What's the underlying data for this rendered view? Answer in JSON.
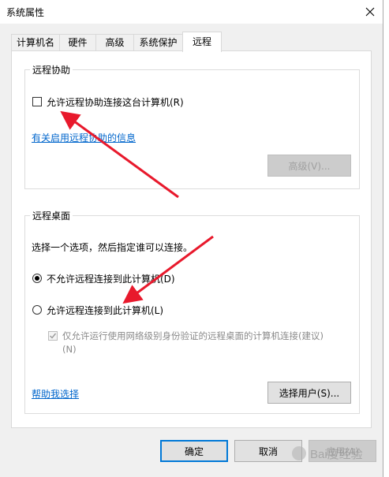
{
  "window": {
    "title": "系统属性",
    "close_icon": "close-icon"
  },
  "tabs": [
    {
      "label": "计算机名",
      "active": false
    },
    {
      "label": "硬件",
      "active": false
    },
    {
      "label": "高级",
      "active": false
    },
    {
      "label": "系统保护",
      "active": false
    },
    {
      "label": "远程",
      "active": true
    }
  ],
  "remote_assistance": {
    "title": "远程协助",
    "allow_label": "允许远程协助连接这台计算机(R)",
    "allow_checked": false,
    "info_link": "有关启用远程协助的信息",
    "advanced_button": "高级(V)..."
  },
  "remote_desktop": {
    "title": "远程桌面",
    "instruction": "选择一个选项，然后指定谁可以连接。",
    "option_deny": "不允许远程连接到此计算机(D)",
    "option_allow": "允许远程连接到此计算机(L)",
    "selected": "deny",
    "nla_label_line1": "仅允许运行使用网络级别身份验证的远程桌面的计算机连接(建议)",
    "nla_label_line2": "(N)",
    "nla_checked": true,
    "help_link": "帮助我选择",
    "select_users_button": "选择用户(S)..."
  },
  "footer": {
    "ok": "确定",
    "cancel": "取消",
    "apply": "应用(A)"
  },
  "colors": {
    "link": "#0066cc",
    "arrow": "#e8192c",
    "accent": "#0078d7"
  },
  "watermark": "Bai度经验"
}
